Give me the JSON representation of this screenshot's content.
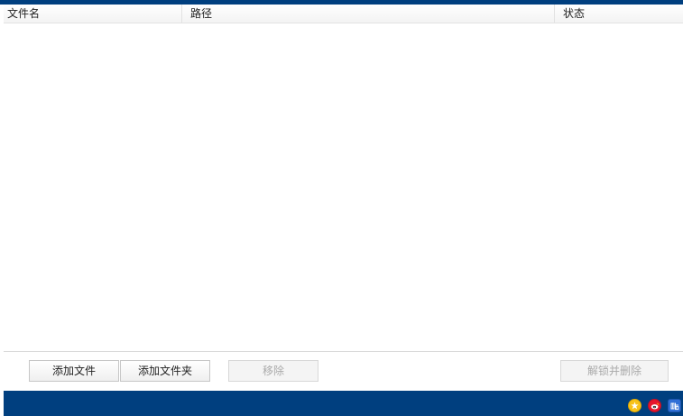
{
  "table": {
    "columns": [
      {
        "label": "文件名"
      },
      {
        "label": "路径"
      },
      {
        "label": "状态"
      }
    ],
    "rows": []
  },
  "actions": {
    "add_file_label": "添加文件",
    "add_folder_label": "添加文件夹",
    "remove_label": "移除",
    "unlock_delete_label": "解锁并删除"
  },
  "footer": {
    "icons": [
      "star-icon",
      "weibo-icon",
      "tieba-icon"
    ]
  },
  "colors": {
    "brand_blue": "#003f7f",
    "star": "#f7c21a",
    "weibo": "#e6162d",
    "tieba": "#2f6fd6"
  }
}
